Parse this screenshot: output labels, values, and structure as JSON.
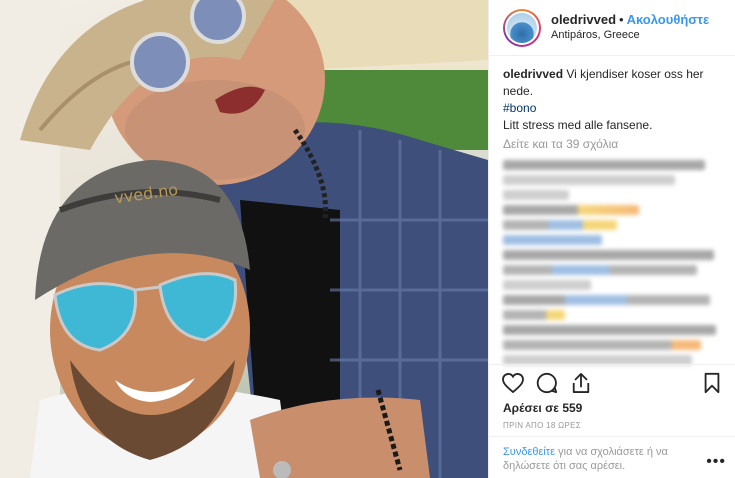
{
  "header": {
    "username": "oledrivved",
    "separator": "•",
    "follow_label": "Ακολουθήστε",
    "location": "Antipáros, Greece"
  },
  "caption": {
    "username": "oledrivved",
    "text": "Vi kjendiser koser oss her nede.",
    "hashtag": "#bono",
    "text2": "Litt stress med alle fansene."
  },
  "view_all_comments": "Δείτε και τα 39 σχόλια",
  "actions": {
    "like_icon": "heart-icon",
    "comment_icon": "comment-icon",
    "share_icon": "share-icon",
    "save_icon": "bookmark-icon"
  },
  "likes": "Αρέσει σε 559",
  "timestamp": "ΠΡΙΝ ΑΠΟ 18 ΩΡΕΣ",
  "footer": {
    "login_link": "Συνδεθείτε",
    "login_text": " για να σχολιάσετε ή να δηλώσετε ότι σας αρέσει.",
    "more": "•••"
  },
  "photo": {
    "cap_text": "vved.no"
  },
  "colors": {
    "accent": "#3897f0",
    "hashtag": "#003569",
    "muted": "#999999"
  }
}
